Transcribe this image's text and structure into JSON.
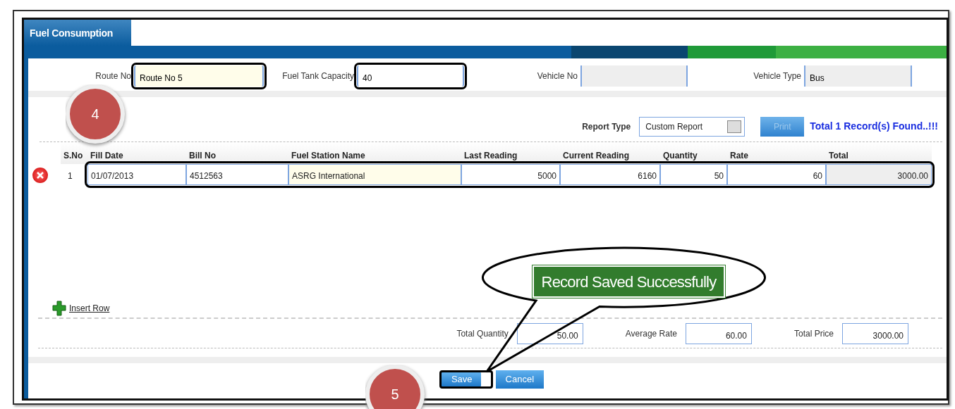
{
  "window": {
    "title": "Fuel Consumption"
  },
  "form": [
    {
      "label": "Route No",
      "value": "Route No 5",
      "kind": "edit",
      "highlighted": true
    },
    {
      "label": "Fuel Tank Capacity",
      "value": "40",
      "kind": "plain",
      "highlighted": true
    },
    {
      "label": "Vehicle No",
      "kind": "readonly",
      "highlighted": false
    },
    {
      "label": "Vehicle Type",
      "value": "Bus",
      "kind": "readonly",
      "highlighted": false
    }
  ],
  "report": {
    "label": "Report Type",
    "value": "Custom Report",
    "print_button": "Print",
    "print_disabled": true,
    "record_count": "Total 1 Record(s) Found..!!!"
  },
  "table": {
    "columns": [
      "S.No",
      "Fill Date",
      "Bill No",
      "Fuel Station Name",
      "Last Reading",
      "Current Reading",
      "Quantity",
      "Rate",
      "Total"
    ],
    "rows": [
      {
        "cells": [
          "1",
          "01/07/2013",
          "4512563",
          "ASRG International",
          "5000",
          "6160",
          "50",
          "60",
          "3000.00"
        ],
        "highlighted": true
      }
    ]
  },
  "insert_row": "Insert Row",
  "totals": [
    {
      "label": "Total Quantity",
      "value": "50.00"
    },
    {
      "label": "Average Rate",
      "value": "60.00"
    },
    {
      "label": "Total Price",
      "value": "3000.00"
    }
  ],
  "buttons": [
    {
      "label": "Save",
      "highlighted": true
    },
    {
      "label": "Cancel",
      "highlighted": false
    }
  ],
  "annotations": [
    {
      "kind": "badge",
      "text": "4"
    },
    {
      "kind": "badge",
      "text": "5"
    },
    {
      "kind": "callout",
      "text": "Record Saved Successfully"
    }
  ]
}
